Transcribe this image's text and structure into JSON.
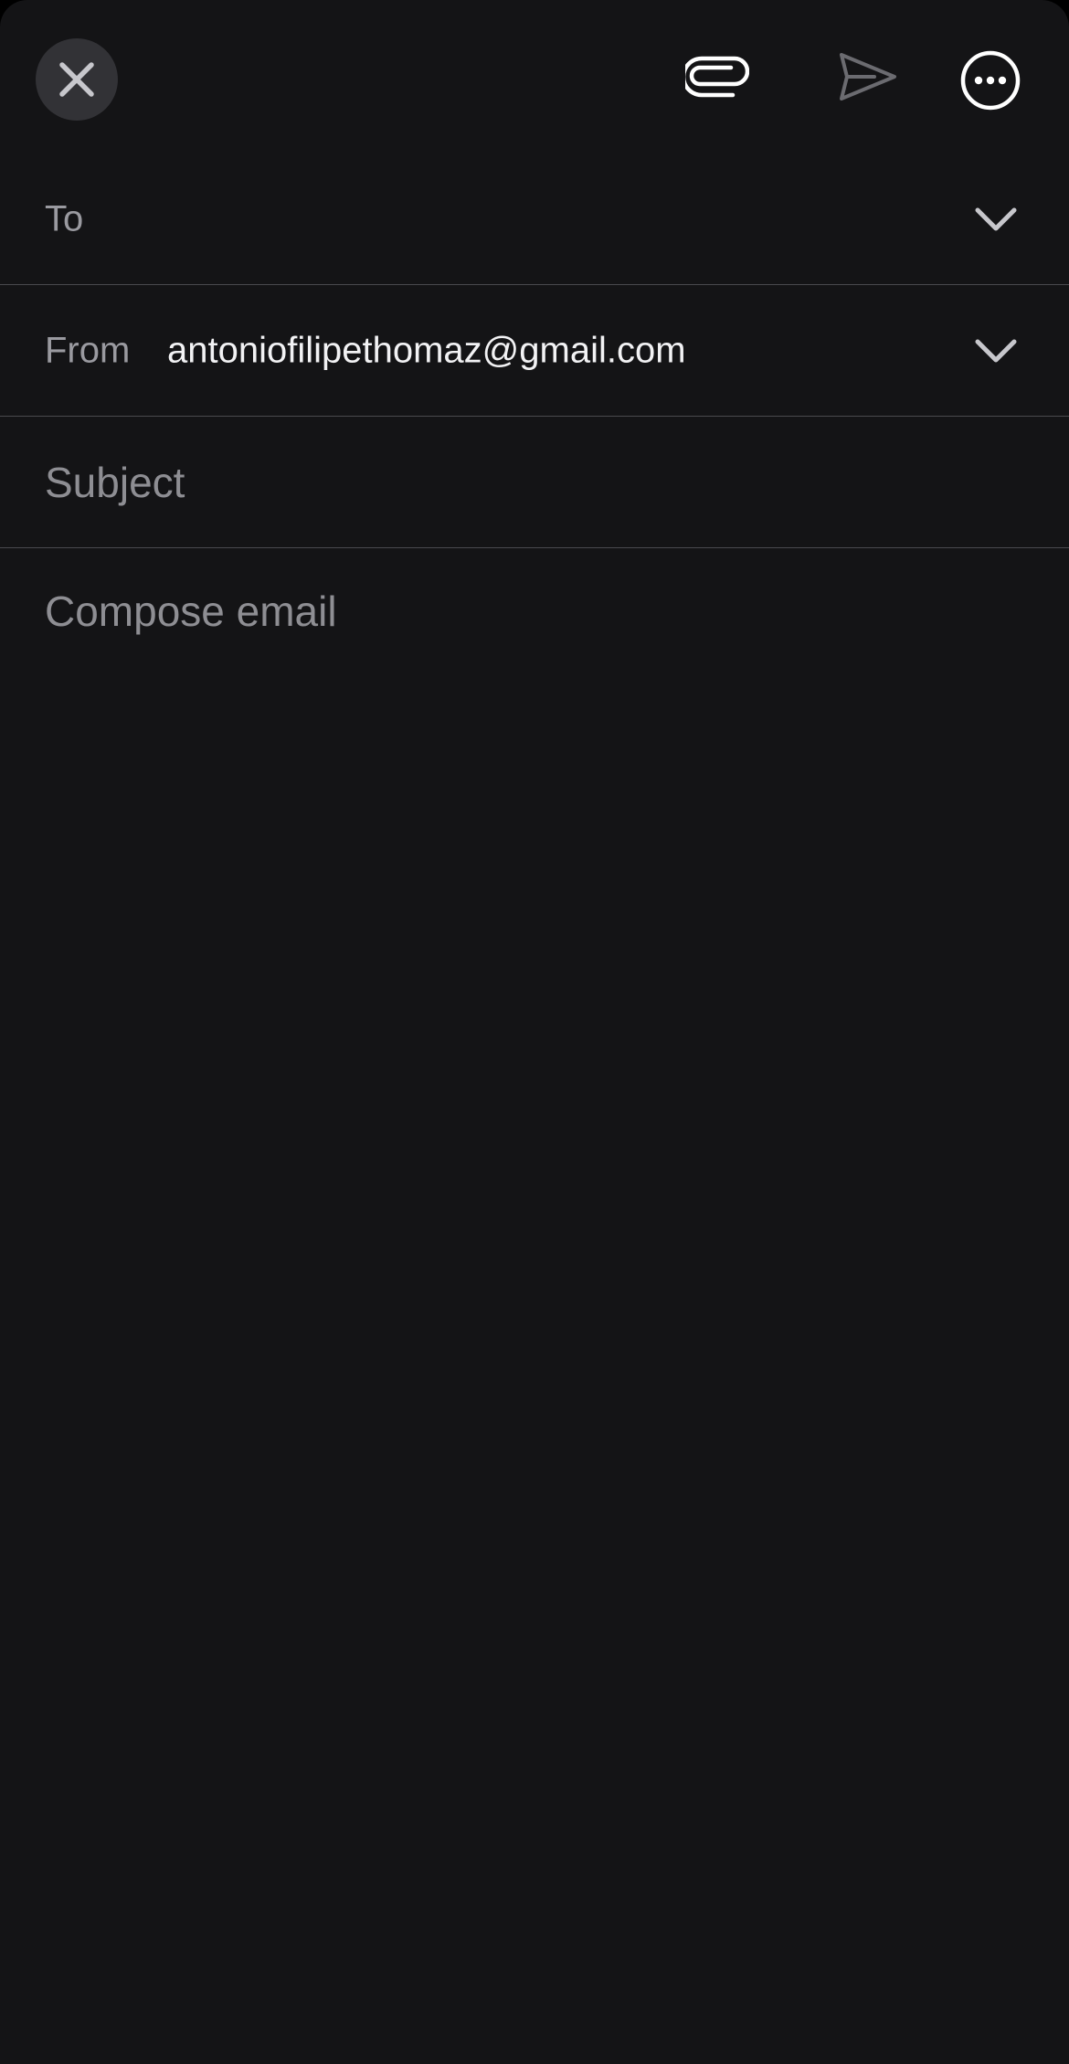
{
  "toolbar": {
    "close_icon": "close-icon",
    "attach_icon": "paperclip-icon",
    "send_icon": "send-icon",
    "more_icon": "more-options-icon"
  },
  "fields": {
    "to_label": "To",
    "from_label": "From",
    "from_value": "antoniofilipethomaz@gmail.com",
    "subject_placeholder": "Subject",
    "body_placeholder": "Compose email"
  },
  "colors": {
    "background": "#141416",
    "close_button_bg": "#323236",
    "label_text": "#9a9aa0",
    "value_text": "#f2f2f4",
    "divider": "#4a4a4e",
    "send_disabled": "#6b6b70"
  }
}
